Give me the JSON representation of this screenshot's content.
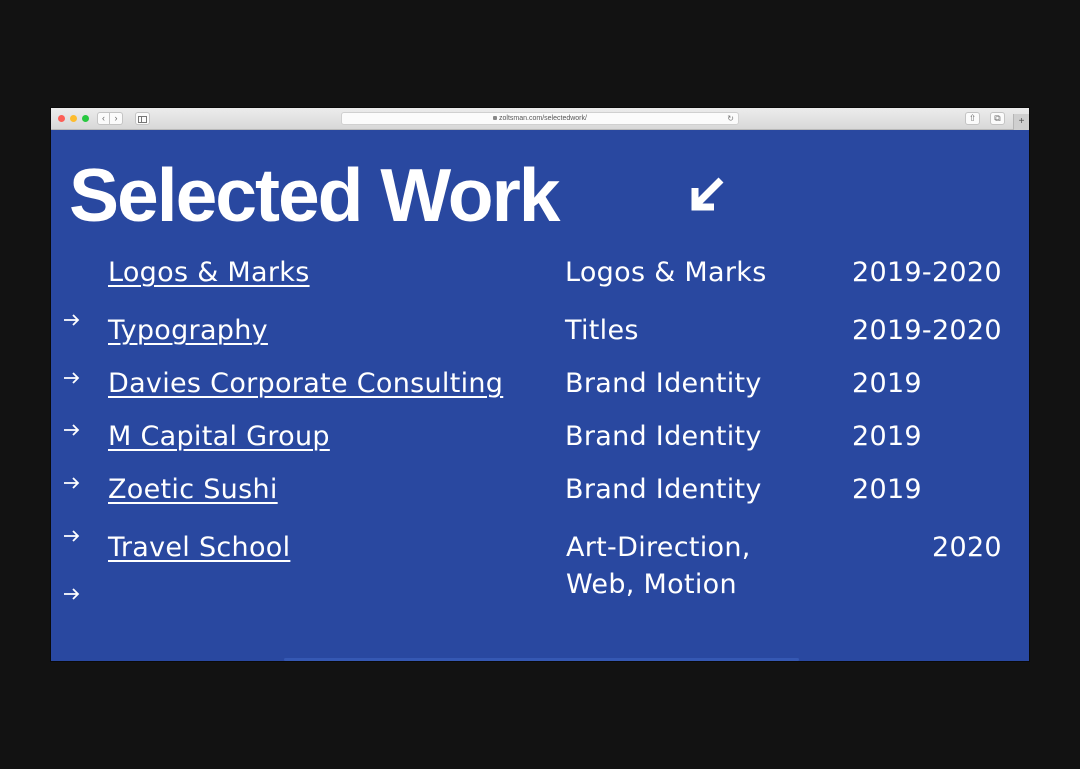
{
  "browser": {
    "url": "zoltsman.com/selectedwork/",
    "back_icon": "‹",
    "forward_icon": "›",
    "reload_icon": "↻",
    "share_icon": "⇧",
    "tabs_icon": "⧉",
    "new_tab_icon": "+"
  },
  "page": {
    "title": "Selected Work",
    "title_arrow_icon": "arrow-down-left-icon",
    "accent_color": "#2948a0"
  },
  "projects": [
    {
      "name": "Logos & Marks",
      "category": "Logos & Marks",
      "year": "2019-2020"
    },
    {
      "name": "Typography",
      "category": "Titles",
      "year": "2019-2020"
    },
    {
      "name": "Davies Corporate Consulting",
      "category": "Brand Identity",
      "year": "2019"
    },
    {
      "name": "M Capital Group",
      "category": "Brand Identity",
      "year": "2019"
    },
    {
      "name": "Zoetic Sushi",
      "category": "Brand Identity",
      "year": "2019"
    },
    {
      "name": "Travel School",
      "category": "Art-Direction, Web, Motion",
      "year": "2020"
    }
  ]
}
